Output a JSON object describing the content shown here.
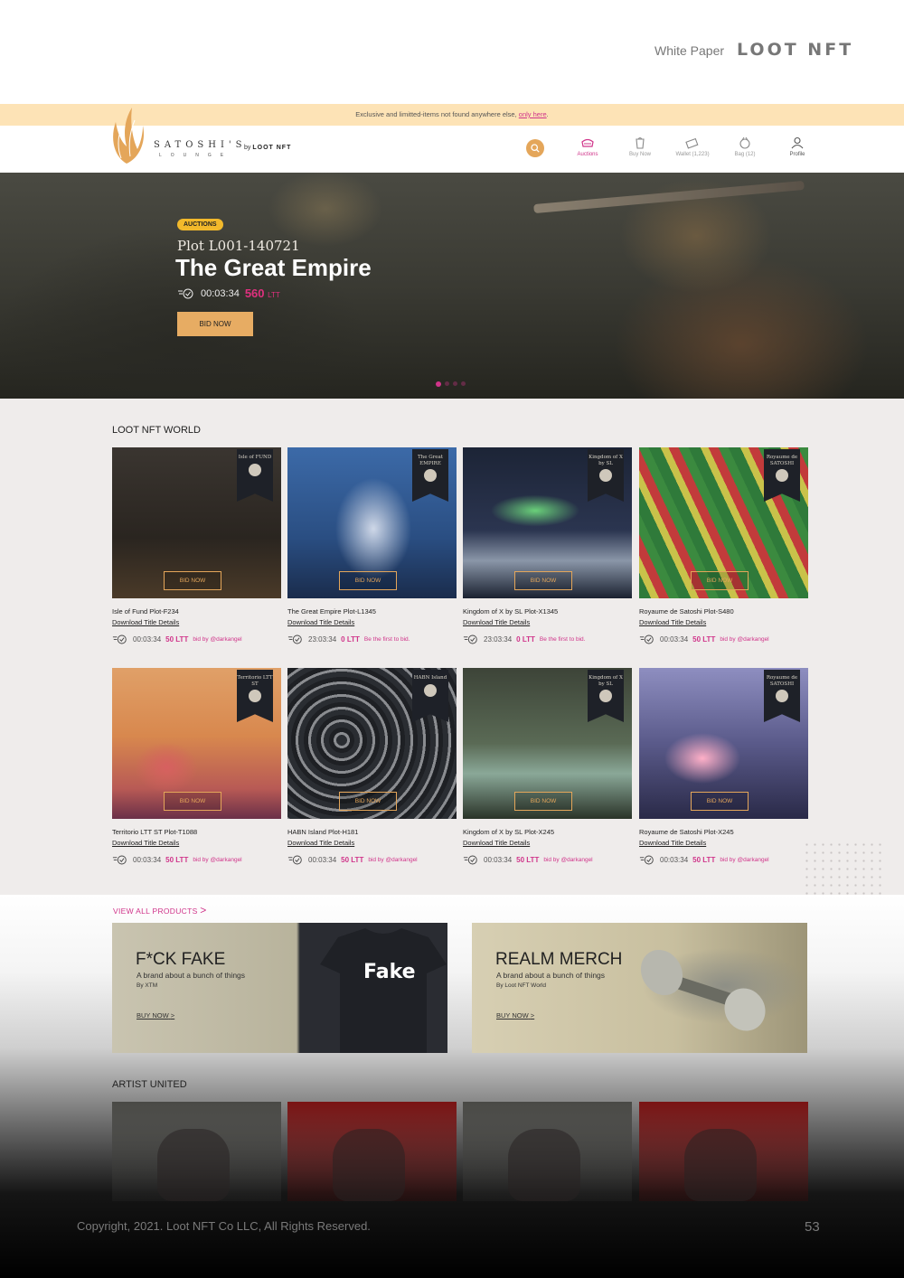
{
  "doc": {
    "white_paper": "White Paper",
    "logo": "LOOT NFT",
    "copyright": "Copyright, 2021. Loot NFT Co LLC, All Rights Reserved.",
    "page_number": "53"
  },
  "announce": {
    "text": "Exclusive and limitted-items not found anywhere else, ",
    "link": "only here",
    "end": "."
  },
  "brand": {
    "name": "SATOSHI'S",
    "sub": "LOUNGE",
    "by": "by",
    "partner": "LOOT NFT"
  },
  "nav": {
    "items": [
      {
        "label": "Auctions",
        "icon": "auction-icon"
      },
      {
        "label": "Buy Now",
        "icon": "buy-icon"
      },
      {
        "label": "Wallet (1,223)",
        "icon": "wallet-icon"
      },
      {
        "label": "Bag (12)",
        "icon": "bag-icon"
      },
      {
        "label": "Profile",
        "icon": "profile-icon"
      }
    ]
  },
  "hero": {
    "badge": "AUCTIONS",
    "plot": "Plot L001-140721",
    "title": "The Great Empire",
    "timer": "00:03:34",
    "price": "560",
    "unit": "LTT",
    "bid_label": "BID NOW",
    "slides": 4,
    "active_slide": 1
  },
  "world": {
    "title": "LOOT NFT WORLD",
    "bid_label": "BID NOW",
    "download_label": "Download Title Details",
    "cards": [
      {
        "name": "Isle of Fund Plot-F234",
        "banner": "Isle of FUND",
        "timer": "00:03:34",
        "price": "50 LTT",
        "bid": "bid by @darkangel"
      },
      {
        "name": "The Great Empire Plot-L1345",
        "banner": "The Great EMPIRE",
        "timer": "23:03:34",
        "price": "0 LTT",
        "bid": "Be the first to bid."
      },
      {
        "name": "Kingdom of X by SL Plot-X1345",
        "banner": "Kingdom of X by SL",
        "timer": "23:03:34",
        "price": "0 LTT",
        "bid": "Be the first to bid."
      },
      {
        "name": "Royaume de Satoshi Plot-S480",
        "banner": "Royaume de SATOSHI",
        "timer": "00:03:34",
        "price": "50 LTT",
        "bid": "bid by @darkangel"
      },
      {
        "name": "Territorio LTT ST Plot-T1088",
        "banner": "Territorio LTT ST",
        "timer": "00:03:34",
        "price": "50 LTT",
        "bid": "bid by @darkangel"
      },
      {
        "name": "HABN Island Plot-H181",
        "banner": "HABN Island",
        "timer": "00:03:34",
        "price": "50 LTT",
        "bid": "bid by @darkangel"
      },
      {
        "name": "Kingdom of X by SL Plot-X245",
        "banner": "Kingdom of X by SL",
        "timer": "00:03:34",
        "price": "50 LTT",
        "bid": "bid by @darkangel"
      },
      {
        "name": "Royaume de Satoshi Plot-X245",
        "banner": "Royaume de SATOSHI",
        "timer": "00:03:34",
        "price": "50 LTT",
        "bid": "bid by @darkangel"
      }
    ]
  },
  "products": {
    "view_all": "VIEW ALL PRODUCTS",
    "promos": [
      {
        "title": "F*CK FAKE",
        "desc": "A brand about a bunch of things",
        "by": "By XTM",
        "cta": "BUY NOW",
        "print": "Fake"
      },
      {
        "title": "REALM MERCH",
        "desc": "A brand about a bunch of things",
        "by": "By Loot NFT World",
        "cta": "BUY NOW"
      }
    ]
  },
  "artists": {
    "title": "ARTIST UNITED"
  }
}
